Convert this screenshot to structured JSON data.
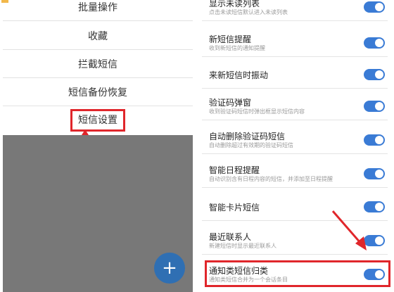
{
  "left_menu": {
    "items": [
      {
        "label": "批量操作"
      },
      {
        "label": "收藏"
      },
      {
        "label": "拦截短信"
      },
      {
        "label": "短信备份恢复"
      },
      {
        "label": "短信设置"
      }
    ],
    "fab_symbol": "+"
  },
  "settings": [
    {
      "title": "显示未读列表",
      "sub": "点击未读短信默认进入未读列表",
      "on": true
    },
    {
      "title": "新短信提醒",
      "sub": "收到新短信的通知提醒",
      "on": true
    },
    {
      "title": "来新短信时振动",
      "sub": "",
      "on": true
    },
    {
      "title": "验证码弹窗",
      "sub": "收到验证码短信时弹出框显示短信内容",
      "on": true
    },
    {
      "title": "自动删除验证码短信",
      "sub": "自动删除超过有效期的验证码短信",
      "on": true
    },
    {
      "title": "智能日程提醒",
      "sub": "自动识别含有日程内容的短信，并添加至日程提醒",
      "on": true
    },
    {
      "title": "智能卡片短信",
      "sub": "",
      "on": true
    },
    {
      "title": "最近联系人",
      "sub": "新建短信时显示最近联系人",
      "on": true
    },
    {
      "title": "通知类短信归类",
      "sub": "通知类短信合并为一个会话条目",
      "on": true
    }
  ],
  "colors": {
    "accent": "#3a7bd5",
    "highlight": "#e0262b",
    "overlay": "#787878",
    "fab": "#2f6fb3"
  }
}
